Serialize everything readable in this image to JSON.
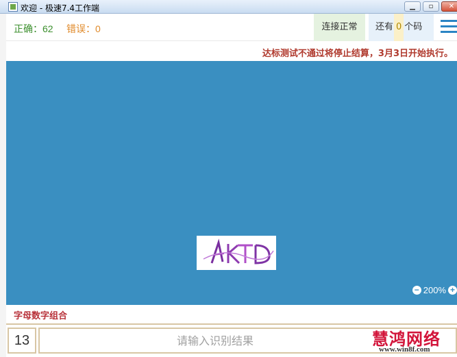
{
  "window": {
    "title": "欢迎 - 极速7.4工作端"
  },
  "status": {
    "correct": "正确：62",
    "error": "错误：0",
    "connection": "连接正常",
    "remain_prefix": "还有",
    "remain_count": "0",
    "remain_suffix": "个码"
  },
  "notice": "达标测试不通过将停止结算，3月3日开始执行。",
  "captcha": {
    "text": "AKTD",
    "zoom": "200%"
  },
  "type_label": "字母数字组合",
  "input": {
    "count": "13",
    "placeholder": "请输入识别结果",
    "value": ""
  },
  "watermark": {
    "main": "慧鸿网络",
    "sub": "www.win8f.com"
  },
  "colors": {
    "stage": "#3a8fc1",
    "accent": "#2a84c4",
    "notice": "#b03a2e",
    "correct": "#3c8f2e",
    "error": "#e08a2a"
  }
}
